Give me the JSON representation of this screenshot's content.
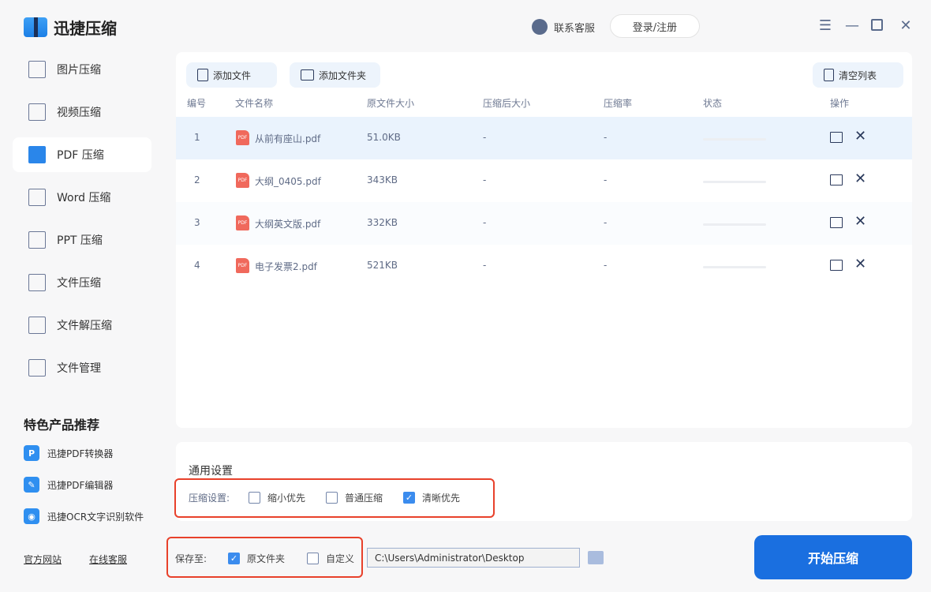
{
  "app": {
    "title": "迅捷压缩"
  },
  "header": {
    "service": "联系客服",
    "login": "登录/注册"
  },
  "sidebar": {
    "items": [
      {
        "label": "图片压缩"
      },
      {
        "label": "视频压缩"
      },
      {
        "label": "PDF 压缩"
      },
      {
        "label": "Word 压缩"
      },
      {
        "label": "PPT 压缩"
      },
      {
        "label": "文件压缩"
      },
      {
        "label": "文件解压缩"
      },
      {
        "label": "文件管理"
      }
    ],
    "featured_title": "特色产品推荐",
    "featured": [
      {
        "label": "迅捷PDF转换器",
        "icon": "P"
      },
      {
        "label": "迅捷PDF编辑器",
        "icon": "✎"
      },
      {
        "label": "迅捷OCR文字识别软件",
        "icon": "◉"
      }
    ],
    "links": {
      "website": "官方网站",
      "support": "在线客服"
    }
  },
  "toolbar": {
    "add_file": "添加文件",
    "add_folder": "添加文件夹",
    "clear": "清空列表"
  },
  "table": {
    "headers": [
      "编号",
      "文件名称",
      "原文件大小",
      "压缩后大小",
      "压缩率",
      "状态",
      "操作"
    ],
    "rows": [
      {
        "no": "1",
        "name": "从前有座山.pdf",
        "size": "51.0KB",
        "after": "-",
        "rate": "-"
      },
      {
        "no": "2",
        "name": "大纲_0405.pdf",
        "size": "343KB",
        "after": "-",
        "rate": "-"
      },
      {
        "no": "3",
        "name": "大纲英文版.pdf",
        "size": "332KB",
        "after": "-",
        "rate": "-"
      },
      {
        "no": "4",
        "name": "电子发票2.pdf",
        "size": "521KB",
        "after": "-",
        "rate": "-"
      }
    ]
  },
  "settings": {
    "title": "通用设置",
    "compress_label": "压缩设置:",
    "options": [
      {
        "label": "缩小优先",
        "checked": false
      },
      {
        "label": "普通压缩",
        "checked": false
      },
      {
        "label": "清晰优先",
        "checked": true
      }
    ]
  },
  "save": {
    "label": "保存至:",
    "original": "原文件夹",
    "custom": "自定义",
    "path": "C:\\Users\\Administrator\\Desktop"
  },
  "start": "开始压缩",
  "colors": {
    "accent": "#1a6fe0",
    "highlight": "#e8412b"
  }
}
